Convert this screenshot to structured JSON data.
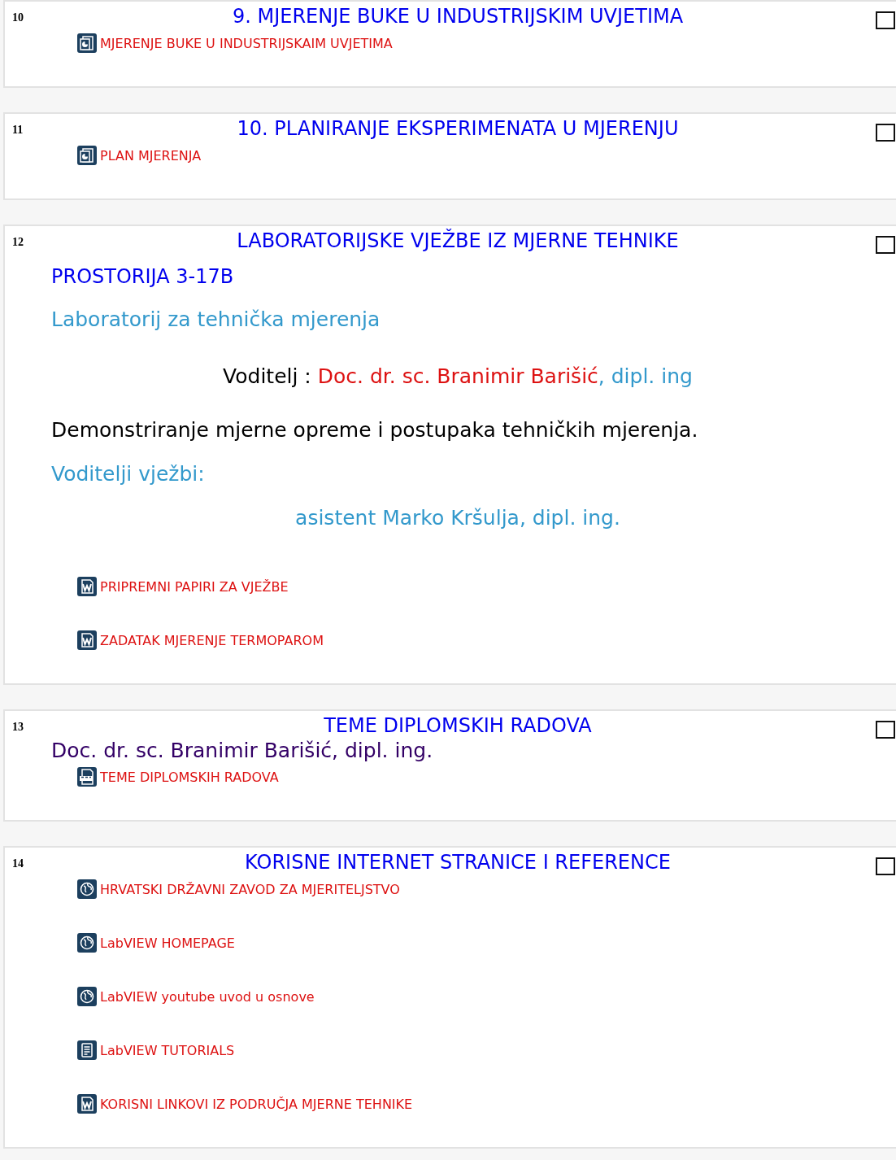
{
  "sections": [
    {
      "number": "10",
      "title": "9. MJERENJE BUKE U INDUSTRIJSKIM UVJETIMA",
      "checked": false,
      "blocks": [
        {
          "kind": "slides",
          "label": "MJERENJE BUKE U INDUSTRIJSKAIM UVJETIMA"
        }
      ]
    },
    {
      "number": "11",
      "title": "10. PLANIRANJE EKSPERIMENATA U MJERENJU",
      "checked": false,
      "blocks": [
        {
          "kind": "slides",
          "label": "PLAN MJERENJA"
        }
      ]
    },
    {
      "number": "12",
      "title": "LABORATORIJSKE VJEŽBE IZ MJERNE TEHNIKE",
      "checked": false,
      "blocks": [
        {
          "kind": "heading",
          "text": "PROSTORIJA 3-17B"
        },
        {
          "kind": "subtitle",
          "text": "Laboratorij za tehnička mjerenja"
        },
        {
          "kind": "leader",
          "parts": [
            {
              "kind": "label",
              "text": "Voditelj : "
            },
            {
              "kind": "name",
              "text": "Doc. dr. sc. Branimir Barišić"
            },
            {
              "kind": "degree",
              "text": ", dipl. ing"
            }
          ]
        },
        {
          "kind": "paragraph",
          "text": "Demonstriranje mjerne opreme i postupaka tehničkih mjerenja."
        },
        {
          "kind": "label",
          "text": "Voditelji vježbi:"
        },
        {
          "kind": "assistant",
          "text": "asistent Marko Kršulja, dipl. ing."
        },
        {
          "kind": "word",
          "label": "PRIPREMNI PAPIRI ZA VJEŽBE"
        },
        {
          "kind": "word",
          "label": "ZADATAK MJERENJE TERMOPAROM"
        }
      ]
    },
    {
      "number": "13",
      "title": "TEME DIPLOMSKIH RADOVA",
      "checked": false,
      "blocks": [
        {
          "kind": "author",
          "text": "Doc. dr. sc. Branimir Barišić, dipl. ing."
        },
        {
          "kind": "pdf",
          "label": "TEME DIPLOMSKIH RADOVA"
        }
      ]
    },
    {
      "number": "14",
      "title": "KORISNE INTERNET STRANICE I REFERENCE",
      "checked": false,
      "blocks": [
        {
          "kind": "web",
          "label": "HRVATSKI DRŽAVNI ZAVOD ZA MJERITELJSTVO"
        },
        {
          "kind": "web",
          "label": "LabVIEW HOMEPAGE"
        },
        {
          "kind": "web",
          "label": "LabVIEW youtube uvod u osnove"
        },
        {
          "kind": "page",
          "label": "LabVIEW TUTORIALS"
        },
        {
          "kind": "word",
          "label": "KORISNI LINKOVI IZ PODRUČJA MJERNE TEHNIKE"
        }
      ]
    }
  ]
}
